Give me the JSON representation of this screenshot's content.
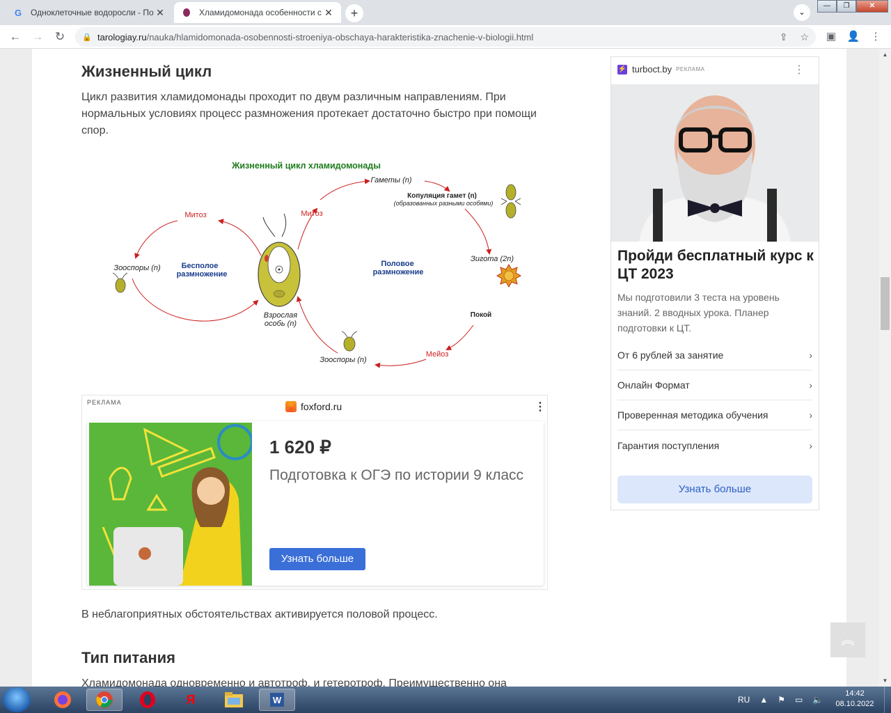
{
  "browser": {
    "tabs": [
      {
        "title": "Одноклеточные водоросли - По",
        "favicon": "G",
        "active": false
      },
      {
        "title": "Хламидомонада особенности с",
        "favicon": "favicon-icon",
        "active": true
      }
    ],
    "url_host": "tarologiay.ru",
    "url_path": "/nauka/hlamidomonada-osobennosti-stroeniya-obschaya-harakteristika-znachenie-v-biologii.html"
  },
  "article": {
    "h_life_cycle": "Жизненный цикл",
    "p_life_cycle": "Цикл развития хламидомонады проходит по двум различным направлениям. При нормальных условиях процесс размножения протекает достаточно быстро при помощи спор.",
    "p_unfavorable": "В неблагоприятных обстоятельствах активируется половой процесс.",
    "h_nutrition": "Тип питания",
    "p_nutrition": "Хламидомонада одновременно и автотроф, и гетеротроф. Преимущественно она"
  },
  "diagram": {
    "title": "Жизненный цикл хламидомонады",
    "mitoz_left": "Митоз",
    "mitoz_right": "Митоз",
    "zoospores_left": "Зооспоры (n)",
    "asexual_1": "Бесполое",
    "asexual_2": "размножение",
    "adult_1": "Взрослая",
    "adult_2": "особь (n)",
    "gametes": "Гаметы (n)",
    "copulation_1": "Копуляция гамет (n)",
    "copulation_2": "(образованных разными особями)",
    "sexual_1": "Половое",
    "sexual_2": "размножение",
    "zygote": "Зигота (2n)",
    "rest": "Покой",
    "meiosis": "Мейоз",
    "zoospores_bottom": "Зооспоры (n)"
  },
  "ad_inline": {
    "label": "РЕКЛАМА",
    "brand": "foxford.ru",
    "price": "1 620 ₽",
    "description": "Подготовка к ОГЭ по истории 9 класс",
    "cta": "Узнать больше"
  },
  "ad_side": {
    "brand": "turboct.by",
    "tag": "РЕКЛАМА",
    "headline": "Пройди бесплатный курс к ЦТ 2023",
    "body": "Мы подготовили 3 теста на уровень знаний. 2 вводных урока. Планер подготовки к ЦТ.",
    "links": [
      "От 6 рублей за занятие",
      "Онлайн Формат",
      "Проверенная методика обучения",
      "Гарантия поступления"
    ],
    "cta": "Узнать больше"
  },
  "taskbar": {
    "lang": "RU",
    "time": "14:42",
    "date": "08.10.2022"
  },
  "colors": {
    "accent_blue": "#3b6fd8",
    "diagram_red": "#cc1f1f",
    "diagram_green": "#1e7b1e",
    "diagram_blue": "#1a3d8a"
  }
}
